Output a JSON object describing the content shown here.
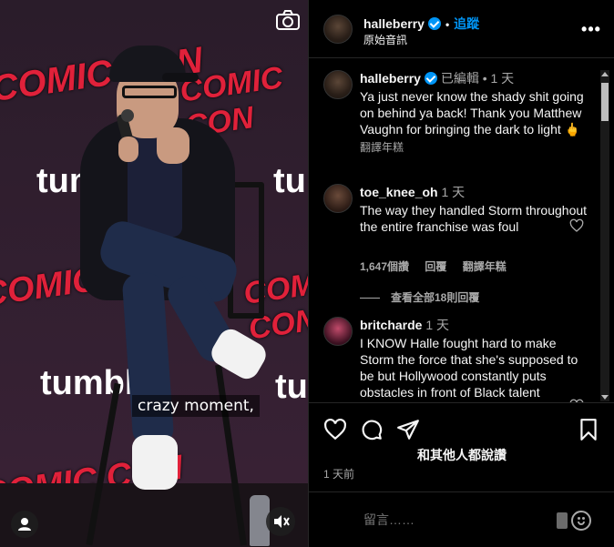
{
  "video": {
    "subtitle": "crazy moment,",
    "backdrop_brand": "COMIC CON",
    "backdrop_sponsor": "tumblr"
  },
  "header": {
    "username": "halleberry",
    "follow_label": "追蹤",
    "audio_label": "原始音訊",
    "more_label": "•••"
  },
  "caption": {
    "username": "halleberry",
    "meta": "已編輯 • 1 天",
    "text": "Ya just never know the shady shit going on behind ya back! Thank you Matthew Vaughn for bringing the dark to light 🖕",
    "translate": "翻譯年糕"
  },
  "comments": [
    {
      "username": "toe_knee_oh",
      "meta": "1 天",
      "text": "The way they handled Storm throughout the entire franchise was foul",
      "likes": "1,647個讚",
      "reply": "回覆",
      "translate": "翻譯年糕",
      "view_replies": "查看全部18則回覆"
    },
    {
      "username": "britcharde",
      "meta": "1 天",
      "text": "I KNOW Halle fought hard to make Storm the force that she's supposed to be but Hollywood constantly puts obstacles in front of Black talent"
    }
  ],
  "post_footer": {
    "likes_text": "和其他人都說讚",
    "time_ago": "1 天前",
    "comment_placeholder": "留言……"
  },
  "colors": {
    "accent": "#0095f6",
    "muted": "#a8a8a8",
    "border": "#262626"
  }
}
